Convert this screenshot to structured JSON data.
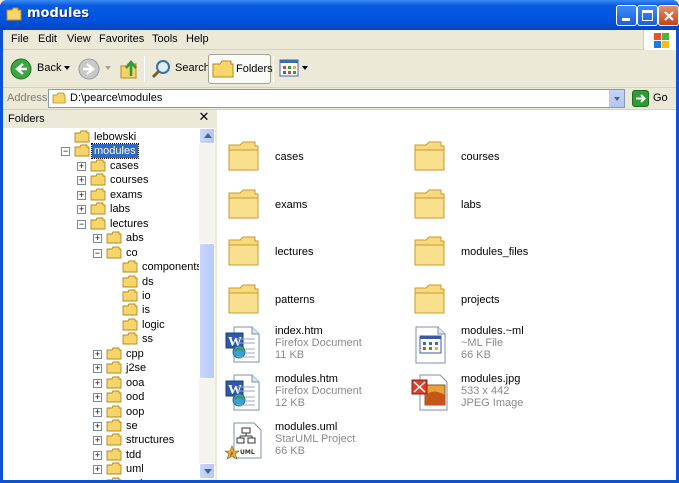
{
  "window": {
    "title": "modules"
  },
  "menu": [
    "File",
    "Edit",
    "View",
    "Favorites",
    "Tools",
    "Help"
  ],
  "toolbar": {
    "back_label": "Back",
    "search_label": "Search",
    "folders_label": "Folders"
  },
  "address": {
    "label": "Address",
    "value": "D:\\pearce\\modules",
    "go_label": "Go"
  },
  "folders_pane": {
    "title": "Folders",
    "close_glyph": "✕",
    "tree": [
      {
        "label": "lebowski",
        "expander": "",
        "level": 0
      },
      {
        "label": "modules",
        "expander": "−",
        "level": 0,
        "selected": true
      },
      {
        "label": "cases",
        "expander": "+",
        "level": 1
      },
      {
        "label": "courses",
        "expander": "+",
        "level": 1
      },
      {
        "label": "exams",
        "expander": "+",
        "level": 1
      },
      {
        "label": "labs",
        "expander": "+",
        "level": 1
      },
      {
        "label": "lectures",
        "expander": "−",
        "level": 1
      },
      {
        "label": "abs",
        "expander": "+",
        "level": 2
      },
      {
        "label": "co",
        "expander": "−",
        "level": 2
      },
      {
        "label": "components",
        "expander": "",
        "level": 3
      },
      {
        "label": "ds",
        "expander": "",
        "level": 3
      },
      {
        "label": "io",
        "expander": "",
        "level": 3
      },
      {
        "label": "is",
        "expander": "",
        "level": 3
      },
      {
        "label": "logic",
        "expander": "",
        "level": 3
      },
      {
        "label": "ss",
        "expander": "",
        "level": 3
      },
      {
        "label": "cpp",
        "expander": "+",
        "level": 2
      },
      {
        "label": "j2se",
        "expander": "+",
        "level": 2
      },
      {
        "label": "ooa",
        "expander": "+",
        "level": 2
      },
      {
        "label": "ood",
        "expander": "+",
        "level": 2
      },
      {
        "label": "oop",
        "expander": "+",
        "level": 2
      },
      {
        "label": "se",
        "expander": "+",
        "level": 2
      },
      {
        "label": "structures",
        "expander": "+",
        "level": 2
      },
      {
        "label": "tdd",
        "expander": "+",
        "level": 2
      },
      {
        "label": "uml",
        "expander": "+",
        "level": 2
      },
      {
        "label": "web",
        "expander": "+",
        "level": 2
      }
    ]
  },
  "content": {
    "items": [
      {
        "name": "cases",
        "type": "folder"
      },
      {
        "name": "courses",
        "type": "folder"
      },
      {
        "name": "exams",
        "type": "folder"
      },
      {
        "name": "labs",
        "type": "folder"
      },
      {
        "name": "lectures",
        "type": "folder"
      },
      {
        "name": "modules_files",
        "type": "folder"
      },
      {
        "name": "patterns",
        "type": "folder"
      },
      {
        "name": "projects",
        "type": "folder"
      },
      {
        "name": "index.htm",
        "type": "htm",
        "kind": "Firefox Document",
        "size": "11 KB"
      },
      {
        "name": "modules.~ml",
        "type": "ml",
        "kind": "~ML File",
        "size": "66 KB"
      },
      {
        "name": "modules.htm",
        "type": "htm",
        "kind": "Firefox Document",
        "size": "12 KB"
      },
      {
        "name": "modules.jpg",
        "type": "jpg",
        "dims": "533 x 442",
        "kind": "JPEG Image"
      },
      {
        "name": "modules.uml",
        "type": "uml",
        "kind": "StarUML Project",
        "size": "66 KB"
      }
    ]
  },
  "colors": {
    "titlebar": "#0054e3",
    "selection": "#316ac5",
    "folder_yellow": "#f5d67a"
  },
  "icons": [
    "folder-icon",
    "back-arrow-icon",
    "forward-arrow-icon",
    "up-folder-icon",
    "search-icon",
    "views-icon",
    "go-arrow-icon",
    "windows-logo-icon"
  ]
}
